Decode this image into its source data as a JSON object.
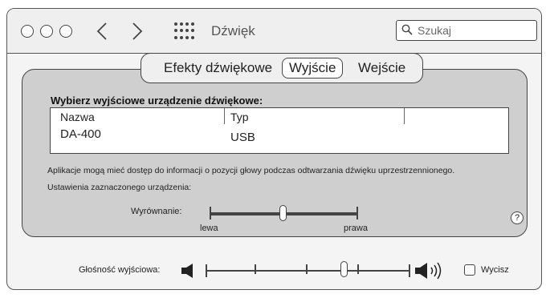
{
  "window": {
    "title": "Dźwięk",
    "search_placeholder": "Szukaj"
  },
  "tabs": [
    {
      "label": "Efekty dźwiękowe",
      "selected": false
    },
    {
      "label": "Wyjście",
      "selected": true
    },
    {
      "label": "Wejście",
      "selected": false
    }
  ],
  "output": {
    "device_heading": "Wybierz wyjściowe urządzenie dźwiękowe:",
    "columns": [
      "Nazwa",
      "Typ"
    ],
    "devices": [
      {
        "name": "DA-400",
        "type": "USB"
      }
    ],
    "info_text": "Aplikacje mogą mieć dostęp do informacji o pozycji głowy podczas odtwarzania dźwięku uprzestrzennionego.",
    "settings_text": "Ustawienia zaznaczonego urządzenia:",
    "balance": {
      "label": "Wyrównanie:",
      "left_label": "lewa",
      "right_label": "prawa",
      "value": 0.5
    },
    "help_label": "?"
  },
  "volume": {
    "label": "Głośność wyjściowa:",
    "value": 0.69,
    "mute_label": "Wycisz",
    "muted": false
  },
  "icons": {
    "back": "chevron-left-icon",
    "forward": "chevron-right-icon",
    "grid": "grid-icon",
    "search": "search-icon",
    "speaker_low": "speaker-low-icon",
    "speaker_high": "speaker-high-icon"
  }
}
